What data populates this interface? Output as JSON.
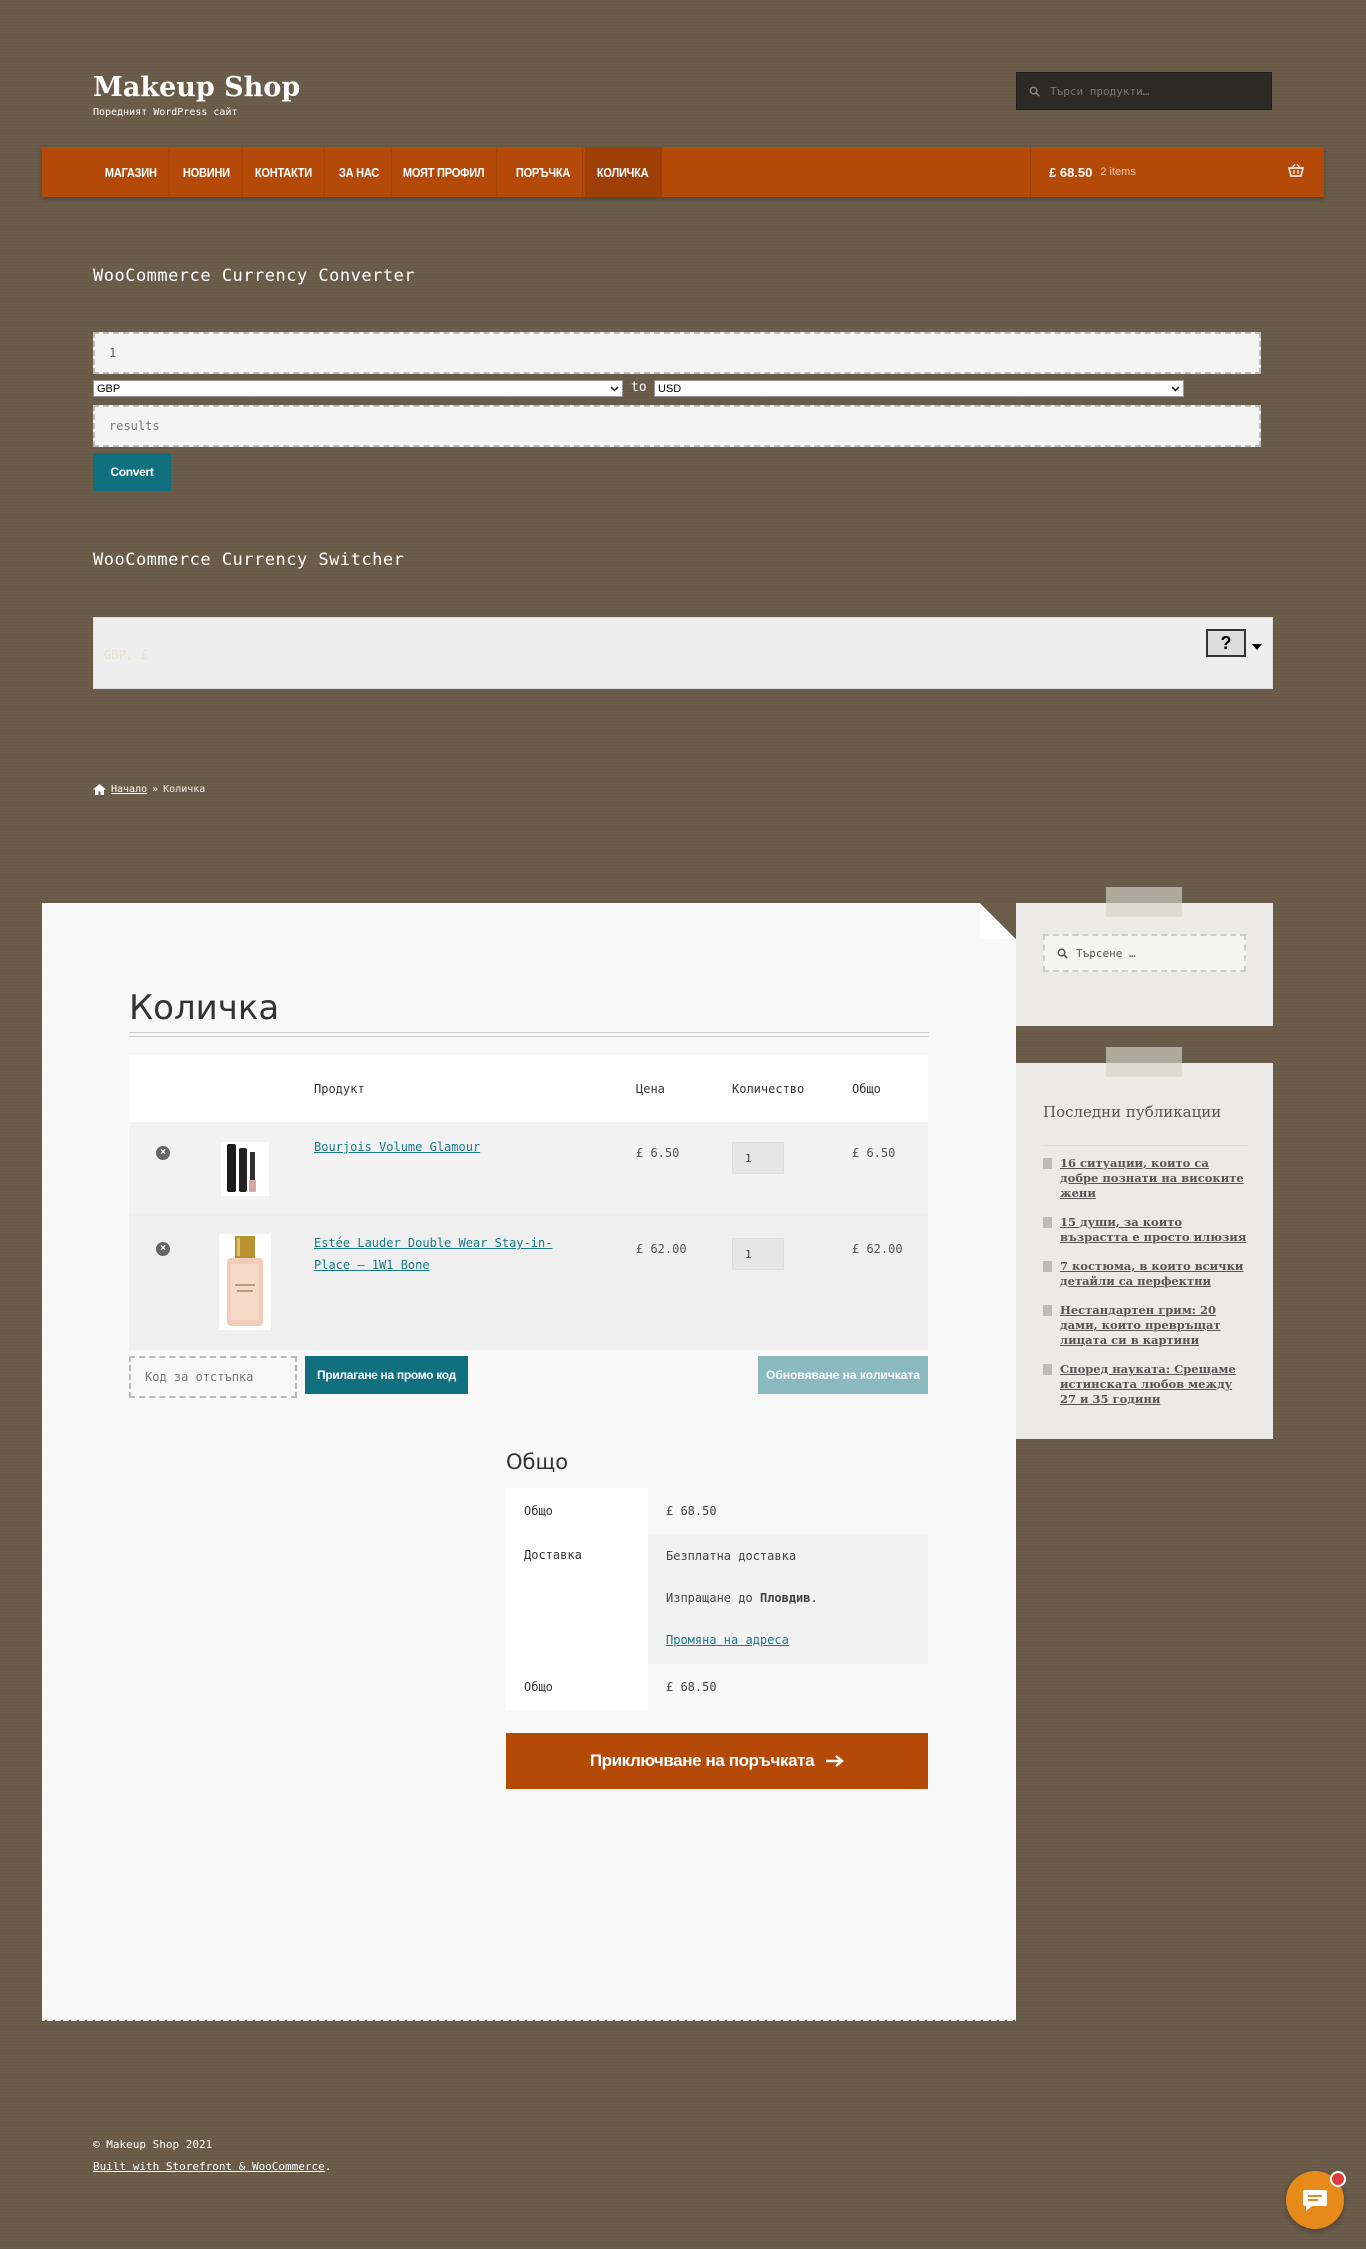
{
  "header": {
    "site_title": "Makeup Shop",
    "site_description": "Поредният WordPress сайт",
    "search_placeholder": "Търси продукти…"
  },
  "nav": {
    "items": [
      {
        "label": "МАГАЗИН"
      },
      {
        "label": "НОВИНИ"
      },
      {
        "label": "КОНТАКТИ"
      },
      {
        "label": "ЗА НАС"
      },
      {
        "label": "МОЯТ ПРОФИЛ"
      },
      {
        "label": "ПОРЪЧКА"
      },
      {
        "label": "КОЛИЧКА",
        "active": true
      }
    ],
    "cart_amount": "£ 68.50",
    "cart_count": "2 items"
  },
  "converter": {
    "title": "WooCommerce Currency Converter",
    "amount_value": "1",
    "from_currency": "GBP",
    "to_label": "to",
    "to_currency": "USD",
    "results_placeholder": "results",
    "convert_label": "Convert"
  },
  "switcher": {
    "title": "WooCommerce Currency Switcher",
    "current": "GBP, £",
    "flag_glyph": "?"
  },
  "breadcrumb": {
    "home": "Начало",
    "separator": "»",
    "current": "Количка"
  },
  "cart": {
    "page_title": "Количка",
    "columns": [
      "Продукт",
      "Цена",
      "Количество",
      "Общо"
    ],
    "items": [
      {
        "name": "Bourjois Volume Glamour",
        "price": "£ 6.50",
        "quantity": "1",
        "subtotal": "£ 6.50"
      },
      {
        "name": "Estée Lauder Double Wear Stay-in-Place – 1W1 Bone",
        "price": "£ 62.00",
        "quantity": "1",
        "subtotal": "£ 62.00"
      }
    ],
    "coupon_placeholder": "Код за отстъпка",
    "apply_coupon_label": "Прилагане на промо код",
    "update_cart_label": "Обновяване на количката"
  },
  "totals": {
    "title": "Общо",
    "subtotal_label": "Общо",
    "subtotal_value": "£ 68.50",
    "shipping_label": "Доставка",
    "shipping_method": "Безплатна доставка",
    "shipping_to_prefix": "Изпращане до",
    "shipping_to_city": "Пловдив",
    "change_address": "Промяна на адреса",
    "total_label": "Общо",
    "total_value": "£ 68.50",
    "checkout_label": "Приключване на поръчката"
  },
  "sidebar": {
    "search_placeholder": "Търсене …",
    "recent_title": "Последни публикации",
    "recent_posts": [
      "16 ситуации, които са добре познати на високите жени",
      "15 души, за които възрастта е просто илюзия",
      "7 костюма, в които всички детайли са перфектни",
      "Нестандартен грим: 20 дами, които превръщат лицата си в картини",
      "Според науката: Срещаме истинската любов между 27 и 35 години"
    ]
  },
  "footer": {
    "copyright": "© Makeup Shop 2021",
    "built_with": "Built with Storefront & WooCommerce",
    "built_with_suffix": "."
  },
  "colors": {
    "background": "#6b5d4a",
    "accent": "#b54a08",
    "button_teal": "#107080",
    "link": "#1a7a8a",
    "chat": "#e68a1a"
  }
}
